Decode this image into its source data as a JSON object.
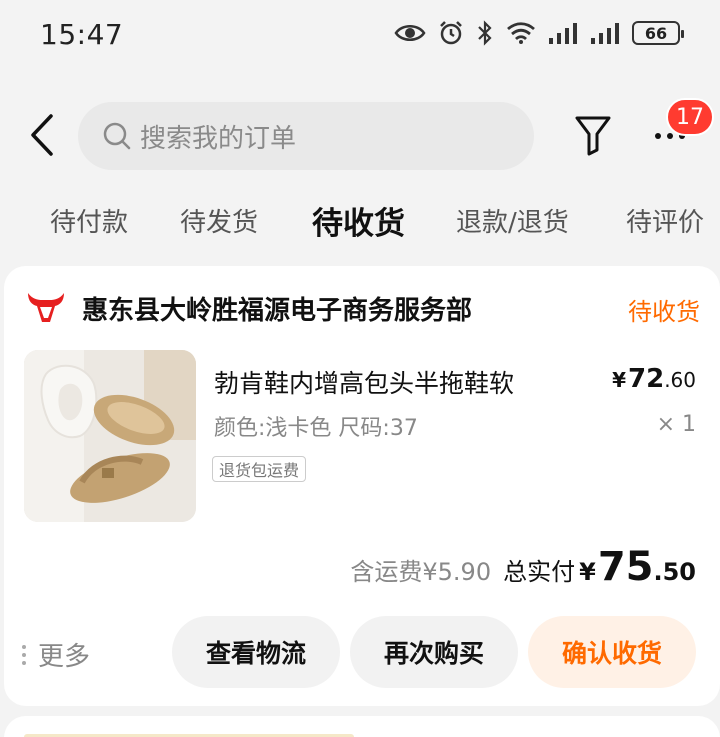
{
  "status_bar": {
    "time": "15:47",
    "battery": "66",
    "icons": [
      "eye-icon",
      "alarm-icon",
      "bluetooth-icon",
      "wifi-icon",
      "signal-icon",
      "signal-icon",
      "battery-icon"
    ]
  },
  "header": {
    "search_placeholder": "搜索我的订单",
    "badge_count": "17"
  },
  "tabs": [
    {
      "label": "待付款",
      "active": false
    },
    {
      "label": "待发货",
      "active": false
    },
    {
      "label": "待收货",
      "active": true
    },
    {
      "label": "退款/退货",
      "active": false
    },
    {
      "label": "待评价",
      "active": false
    }
  ],
  "order": {
    "store_name": "惠东县大岭胜福源电子商务服务部",
    "status": "待收货",
    "product": {
      "title": "勃肯鞋内增高包头半拖鞋软",
      "spec": "颜色:浅卡色 尺码:37",
      "tag": "退货包运费",
      "price_currency": "¥",
      "price_int": "72",
      "price_dec": ".60",
      "quantity": "× 1"
    },
    "shipping": "含运费¥5.90",
    "total_label": "总实付",
    "total_currency": "¥",
    "total_int": "75",
    "total_dec": ".50",
    "actions": {
      "more": "更多",
      "logistics": "查看物流",
      "rebuy": "再次购买",
      "confirm": "确认收货"
    }
  },
  "colors": {
    "accent": "#ff6a00",
    "badge": "#ff3b30",
    "background": "#f3f3f3",
    "confirm_bg": "#fff1e6"
  }
}
